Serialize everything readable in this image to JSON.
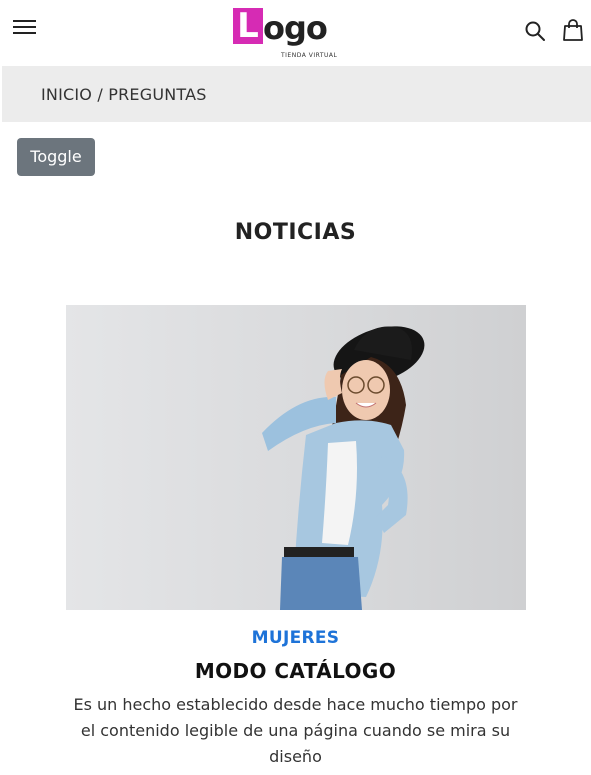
{
  "header": {
    "logo_letter": "L",
    "logo_rest": "ogo",
    "logo_tagline": "TIENDA VIRTUAL",
    "icons": [
      "menu-icon",
      "search-icon",
      "shopping-bag-icon"
    ],
    "accent_color": "#d62bb4"
  },
  "breadcrumb": {
    "text": "INICIO / PREGUNTAS"
  },
  "toggle_label": "Toggle",
  "page_title": "NOTICIAS",
  "article": {
    "category": "MUJERES",
    "category_color": "#1e73d8",
    "title": "MODO CATÁLOGO",
    "excerpt": "Es un hecho establecido desde hace mucho tiempo por el contenido legible de una página cuando se mira su diseño"
  }
}
